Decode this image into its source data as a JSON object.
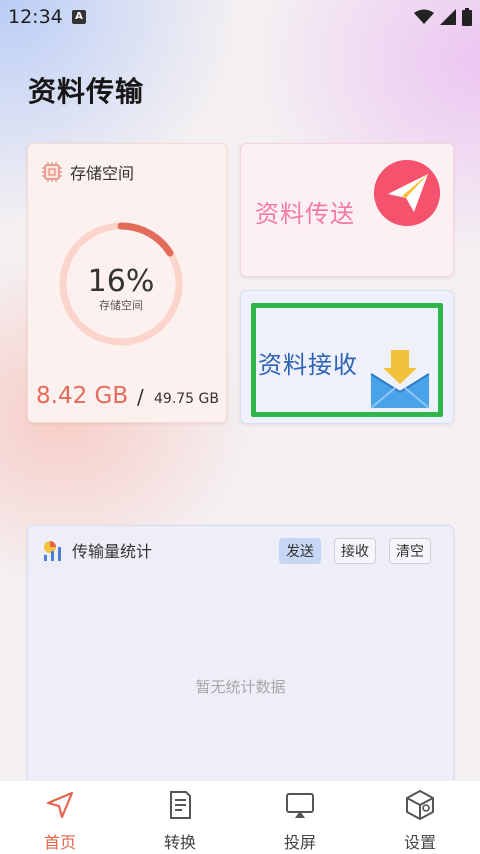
{
  "status_bar": {
    "time": "12:34",
    "notif_icon": "A"
  },
  "app": {
    "title": "资料传输"
  },
  "storage": {
    "title": "存储空间",
    "percent_label": "16%",
    "percent": 0.16,
    "caption": "存储空间",
    "used": "8.42 GB",
    "separator": "/",
    "total": "49.75 GB",
    "colors": {
      "arc": "#e36b5a",
      "track": "#fbd4cc"
    }
  },
  "send": {
    "label": "资料传送",
    "icon": "paper-plane-icon"
  },
  "receive": {
    "label": "资料接收",
    "icon": "mail-download-icon"
  },
  "stats": {
    "title": "传输量统计",
    "buttons": [
      "发送",
      "接收",
      "清空"
    ],
    "empty_text": "暂无统计数据"
  },
  "nav": {
    "items": [
      {
        "label": "首页",
        "icon": "send-icon"
      },
      {
        "label": "转换",
        "icon": "document-icon"
      },
      {
        "label": "投屏",
        "icon": "cast-icon"
      },
      {
        "label": "设置",
        "icon": "settings-box-icon"
      }
    ],
    "active_color": "#e3654d"
  }
}
